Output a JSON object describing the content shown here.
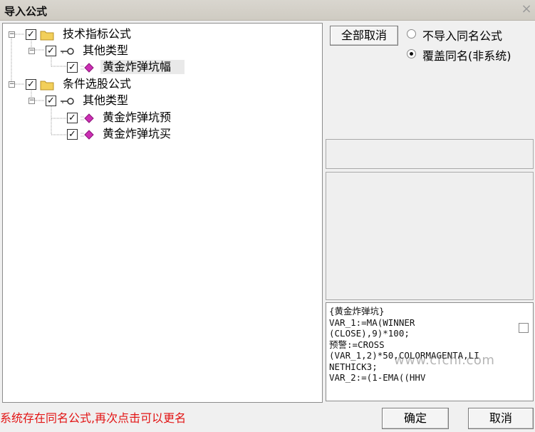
{
  "window": {
    "title": "导入公式"
  },
  "tree": {
    "nodes": [
      {
        "label": "技术指标公式",
        "checked": true,
        "icon": "folder-icon"
      },
      {
        "label": "其他类型",
        "checked": true,
        "icon": "key-icon"
      },
      {
        "label": "黄金炸弹坑幅",
        "checked": true,
        "icon": "formula-icon"
      },
      {
        "label": "条件选股公式",
        "checked": true,
        "icon": "folder-icon"
      },
      {
        "label": "其他类型",
        "checked": true,
        "icon": "key-icon"
      },
      {
        "label": "黄金炸弹坑预",
        "checked": true,
        "icon": "formula-icon"
      },
      {
        "label": "黄金炸弹坑买",
        "checked": true,
        "icon": "formula-icon"
      }
    ]
  },
  "options": {
    "cancel_all_label": "全部取消",
    "radio_no_import": "不导入同名公式",
    "radio_overwrite": "覆盖同名(非系统)",
    "selected": "overwrite"
  },
  "preview": {
    "text": "{黄金炸弹坑}\nVAR_1:=MA(WINNER\n(CLOSE),9)*100;\n预警:=CROSS\n(VAR_1,2)*50,COLORMAGENTA,LI\nNETHICK3;\nVAR_2:=(1-EMA((HHV",
    "watermark": "www.cfchi.com"
  },
  "footer": {
    "status": "系统存在同名公式,再次点击可以更名",
    "ok_label": "确定",
    "cancel_label": "取消"
  },
  "colors": {
    "status_red": "#e21414",
    "folder": "#f2cf5a",
    "diamond": "#cc2fb4"
  }
}
